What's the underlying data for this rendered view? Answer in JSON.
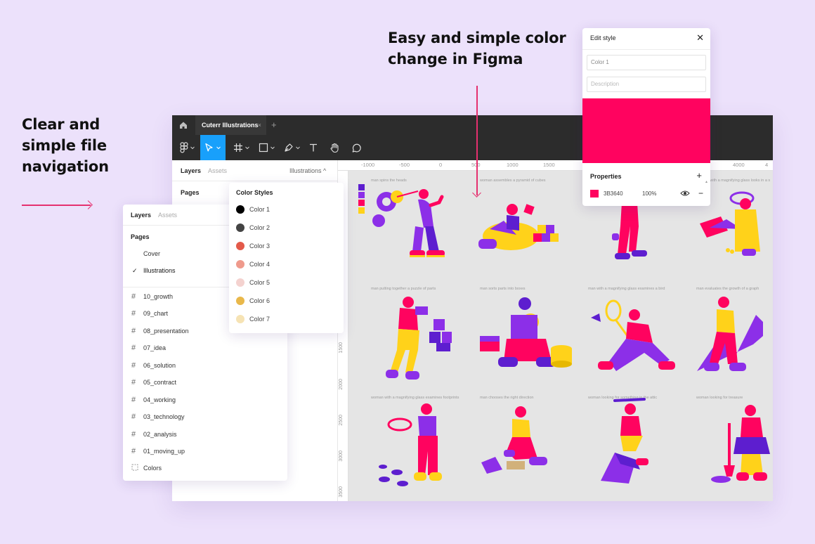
{
  "headlines": {
    "left": [
      "Clear and",
      "simple file",
      "navigation"
    ],
    "top": [
      "Easy and simple color",
      "change in Figma"
    ]
  },
  "figma": {
    "file_tab": "Cuterr Illustrations",
    "tab_close": "×",
    "tab_add": "+",
    "left_panel": {
      "tab_layers": "Layers",
      "tab_assets": "Assets",
      "page_switcher": "Illustrations ^",
      "pages_heading": "Pages"
    },
    "ruler_top": [
      "-1000",
      "-500",
      "0",
      "500",
      "1000",
      "1500",
      "4000",
      "4"
    ],
    "ruler_left": [
      "1500",
      "2000",
      "2500",
      "3000",
      "3500"
    ],
    "canvas_swatches": [
      "#5d1ecf",
      "#8c2fe8",
      "#ff035f",
      "#ffd21a"
    ],
    "captions": [
      "man spins the heads",
      "woman assembles a pyramid of cubes",
      "woman with a magnifying glass looks in a s",
      "man putting together a puzzle of parts",
      "man sorts parts into boxes",
      "man with a magnifying glass examines a bird",
      "man evaluates the growth of a graph",
      "woman with a magnifying glass examines footprints",
      "man chooses the right direction",
      "woman looking for something in the attic",
      "woman looking for treasure"
    ]
  },
  "layers": {
    "tab_layers": "Layers",
    "tab_assets": "Assets",
    "pages_heading": "Pages",
    "pages": [
      "Cover",
      "Illustrations"
    ],
    "checkmark": "✓",
    "frames": [
      "10_growth",
      "09_chart",
      "08_presentation",
      "07_idea",
      "06_solution",
      "05_contract",
      "04_working",
      "03_technology",
      "02_analysis",
      "01_moving_up",
      "Colors"
    ]
  },
  "color_styles": {
    "title": "Color Styles",
    "items": [
      {
        "label": "Color 1",
        "color": "#000000"
      },
      {
        "label": "Color 2",
        "color": "#444444"
      },
      {
        "label": "Color 3",
        "color": "#e35a4a"
      },
      {
        "label": "Color 4",
        "color": "#ef9a8c"
      },
      {
        "label": "Color 5",
        "color": "#f4d2cf"
      },
      {
        "label": "Color 6",
        "color": "#e9b84a"
      },
      {
        "label": "Color 7",
        "color": "#f6e3b4"
      }
    ]
  },
  "edit_style": {
    "title": "Edit style",
    "close": "✕",
    "name_value": "Color 1",
    "description_placeholder": "Description",
    "swatch_color": "#ff035f",
    "properties_heading": "Properties",
    "add": "+",
    "hex": "3B3640",
    "opacity": "100%",
    "remove": "−"
  }
}
